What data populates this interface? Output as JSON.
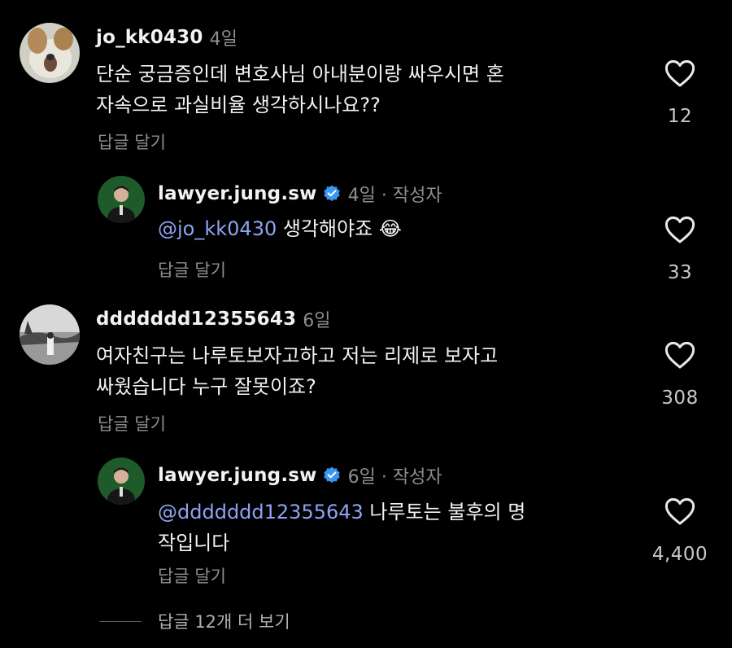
{
  "comments": [
    {
      "username": "jo_kk0430",
      "age": "4일",
      "text_lines": [
        "단순 궁금증인데 변호사님 아내분이랑 싸우시면 혼",
        "자속으로 과실비율 생각하시나요??"
      ],
      "reply_label": "답글 달기",
      "likes": "12"
    },
    {
      "username": "lawyer.jung.sw",
      "age": "4일 · 작성자",
      "mention": "@jo_kk0430",
      "text_rest": " 생각해야죠 ",
      "emoji": "😂",
      "reply_label": "답글 달기",
      "likes": "33"
    },
    {
      "username": "ddddddd12355643",
      "age": "6일",
      "text_lines": [
        "여자친구는 나루토보자고하고 저는 리제로 보자고",
        "싸웠습니다 누구 잘못이죠?"
      ],
      "reply_label": "답글 달기",
      "likes": "308"
    },
    {
      "username": "lawyer.jung.sw",
      "age": "6일 · 작성자",
      "mention": "@ddddddd12355643",
      "text_rest": " 나루토는 불후의 명",
      "text_line2": "작입니다",
      "reply_label": "답글 달기",
      "likes": "4,400"
    }
  ],
  "view_more": "답글 12개 더 보기",
  "icons": {
    "like": "heart-outline-icon",
    "verified": "verified-badge-icon"
  },
  "colors": {
    "background": "#000000",
    "mention": "#8ea3f3",
    "verified": "#3897f0",
    "muted": "#8e8e8e"
  }
}
